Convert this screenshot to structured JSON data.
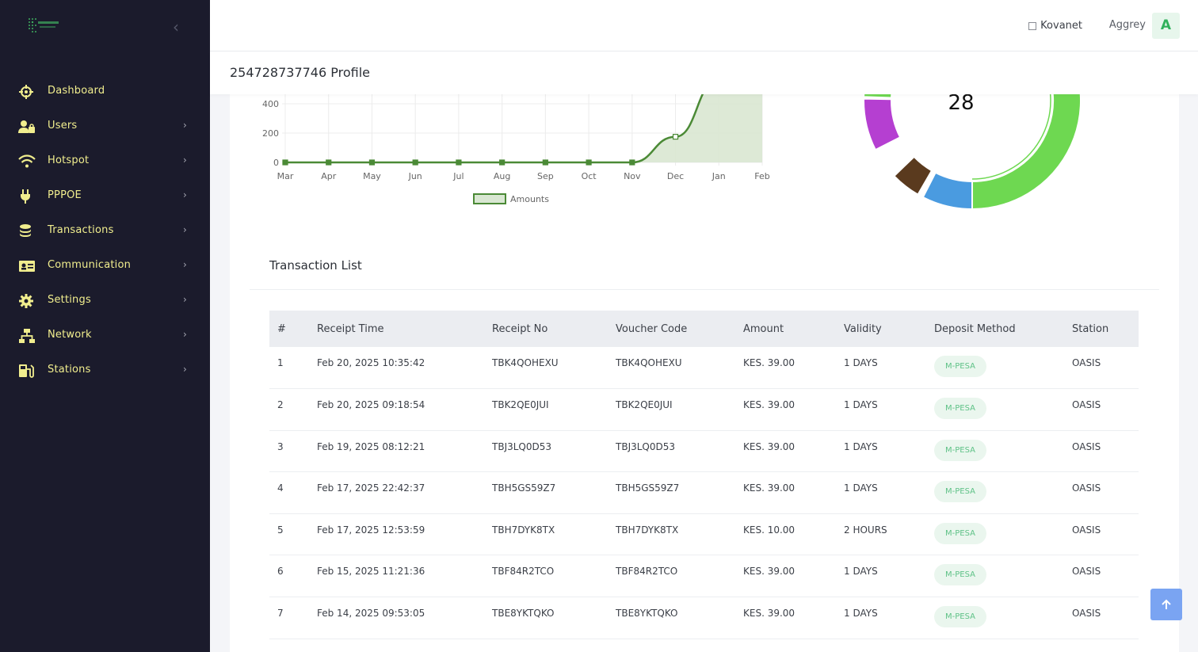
{
  "sidebar": {
    "items": [
      {
        "label": "Dashboard",
        "icon": "dashboard-icon"
      },
      {
        "label": "Users",
        "icon": "users-icon"
      },
      {
        "label": "Hotspot",
        "icon": "wifi-icon"
      },
      {
        "label": "PPPOE",
        "icon": "plug-icon"
      },
      {
        "label": "Transactions",
        "icon": "coins-icon"
      },
      {
        "label": "Communication",
        "icon": "contact-card-icon"
      },
      {
        "label": "Settings",
        "icon": "gear-icon"
      },
      {
        "label": "Network",
        "icon": "network-icon"
      },
      {
        "label": "Stations",
        "icon": "station-icon"
      }
    ]
  },
  "header": {
    "org": "Kovanet",
    "username": "Aggrey",
    "avatar_letter": "A"
  },
  "page": {
    "title": "254728737746 Profile"
  },
  "chart_data": [
    {
      "type": "area",
      "categories": [
        "Mar",
        "Apr",
        "May",
        "Jun",
        "Jul",
        "Aug",
        "Sep",
        "Oct",
        "Nov",
        "Dec",
        "Jan",
        "Feb"
      ],
      "series": [
        {
          "name": "Amounts",
          "values": [
            0,
            0,
            0,
            0,
            0,
            0,
            0,
            0,
            0,
            175,
            700,
            700
          ]
        }
      ],
      "yticks": [
        "0",
        "200",
        "400"
      ],
      "ylim": [
        0,
        450
      ],
      "color": "#4b8a36",
      "fill": "#d9e7d2"
    },
    {
      "type": "pie",
      "center_label": "28",
      "colors": [
        "#6ed851",
        "#4a9be0",
        "#5a3a1e",
        "#b53fd1",
        "#6ed851"
      ]
    }
  ],
  "transactions": {
    "title": "Transaction List",
    "columns": [
      "#",
      "Receipt Time",
      "Receipt No",
      "Voucher Code",
      "Amount",
      "Validity",
      "Deposit Method",
      "Station"
    ],
    "rows": [
      {
        "n": "1",
        "time": "Feb 20, 2025 10:35:42",
        "receipt": "TBK4QOHEXU",
        "voucher": "TBK4QOHEXU",
        "amount": "KES. 39.00",
        "validity": "1 DAYS",
        "method": "M-PESA",
        "station": "OASIS"
      },
      {
        "n": "2",
        "time": "Feb 20, 2025 09:18:54",
        "receipt": "TBK2QE0JUI",
        "voucher": "TBK2QE0JUI",
        "amount": "KES. 39.00",
        "validity": "1 DAYS",
        "method": "M-PESA",
        "station": "OASIS"
      },
      {
        "n": "3",
        "time": "Feb 19, 2025 08:12:21",
        "receipt": "TBJ3LQ0D53",
        "voucher": "TBJ3LQ0D53",
        "amount": "KES. 39.00",
        "validity": "1 DAYS",
        "method": "M-PESA",
        "station": "OASIS"
      },
      {
        "n": "4",
        "time": "Feb 17, 2025 22:42:37",
        "receipt": "TBH5GS59Z7",
        "voucher": "TBH5GS59Z7",
        "amount": "KES. 39.00",
        "validity": "1 DAYS",
        "method": "M-PESA",
        "station": "OASIS"
      },
      {
        "n": "5",
        "time": "Feb 17, 2025 12:53:59",
        "receipt": "TBH7DYK8TX",
        "voucher": "TBH7DYK8TX",
        "amount": "KES. 10.00",
        "validity": "2 HOURS",
        "method": "M-PESA",
        "station": "OASIS"
      },
      {
        "n": "6",
        "time": "Feb 15, 2025 11:21:36",
        "receipt": "TBF84R2TCO",
        "voucher": "TBF84R2TCO",
        "amount": "KES. 39.00",
        "validity": "1 DAYS",
        "method": "M-PESA",
        "station": "OASIS"
      },
      {
        "n": "7",
        "time": "Feb 14, 2025 09:53:05",
        "receipt": "TBE8YKTQKO",
        "voucher": "TBE8YKTQKO",
        "amount": "KES. 39.00",
        "validity": "1 DAYS",
        "method": "M-PESA",
        "station": "OASIS"
      }
    ]
  }
}
